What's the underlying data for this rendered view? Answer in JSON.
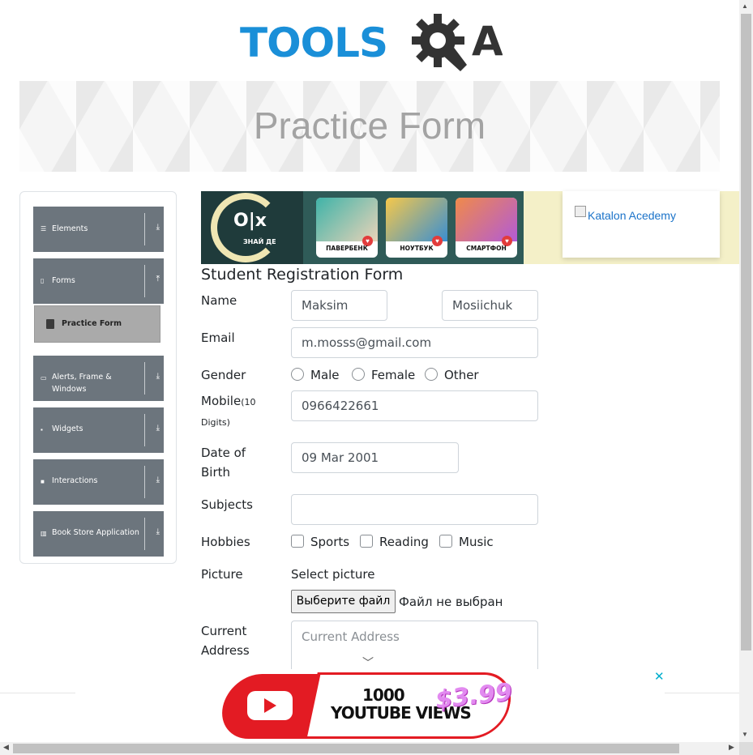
{
  "logo": {
    "text": "TOOLS",
    "suffix": "A",
    "alt": "TOOLSQA"
  },
  "banner": {
    "title": "Practice Form"
  },
  "sidebar": {
    "groups": [
      {
        "label": "Elements",
        "icon": "menu-lines-icon",
        "arrow": "⤓"
      },
      {
        "label": "Forms",
        "icon": "document-icon",
        "arrow": "⤒"
      },
      {
        "label": "Alerts, Frame &",
        "label2": "Windows",
        "icon": "window-icon",
        "arrow": "⤓"
      },
      {
        "label": "Widgets",
        "icon": "grid-icon",
        "arrow": "⤓"
      },
      {
        "label": "Interactions",
        "icon": "square-icon",
        "arrow": "⤓"
      },
      {
        "label": "Book Store Application",
        "icon": "book-icon",
        "arrow": "⤓"
      }
    ],
    "active_item": "Practice Form"
  },
  "ad_top": {
    "brand": "O|x",
    "tagline": "ЗНАЙ ДЕ",
    "cards": [
      "ПАВЕРБЕНК",
      "НОУТБУК",
      "СМАРТФОН"
    ]
  },
  "katalon": {
    "link_text": "Katalon Acedemy"
  },
  "form": {
    "title": "Student Registration Form",
    "name_label": "Name",
    "first_name": "Maksim",
    "last_name": "Mosiichuk",
    "email_label": "Email",
    "email": "m.mosss@gmail.com",
    "gender_label": "Gender",
    "genders": [
      "Male",
      "Female",
      "Other"
    ],
    "mobile_label": "Mobile",
    "mobile_hint": "(10",
    "mobile_hint2": "Digits)",
    "mobile": "0966422661",
    "dob_label": "Date of",
    "dob_label2": "Birth",
    "dob": "09 Mar 2001",
    "subjects_label": "Subjects",
    "hobbies_label": "Hobbies",
    "hobbies": [
      "Sports",
      "Reading",
      "Music"
    ],
    "picture_label": "Picture",
    "select_picture": "Select picture",
    "file_button": "Выберите файл",
    "file_status": "Файл не выбран",
    "address_label": "Current",
    "address_label2": "Address",
    "address_placeholder": "Current Address"
  },
  "ad_bottom": {
    "line1": "1000",
    "line2": "YOUTUBE VIEWS",
    "price": "$3.99",
    "close": "✕"
  },
  "colors": {
    "accent": "#1a8fd8",
    "sidebar": "#6c757d",
    "active": "#aaaaaa"
  }
}
